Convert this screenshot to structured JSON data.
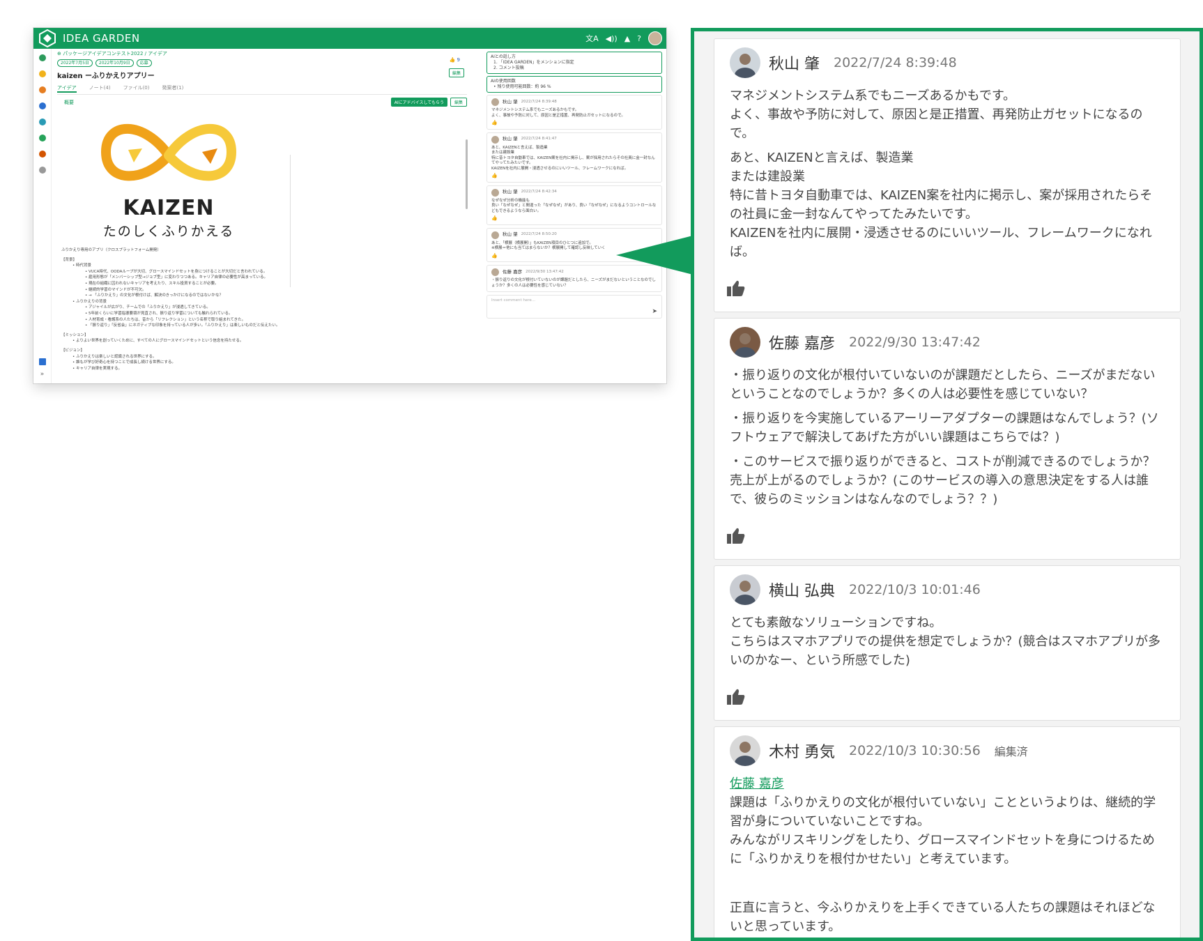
{
  "app": {
    "title": "IDEA GARDEN",
    "breadcrumb": "パッケージアイデアコンテスト2022 / アイデア",
    "chips": [
      "2022年7月5日",
      "2022年10月9日",
      "応募"
    ],
    "idea_title": "kaizen ーふりかえりアプリー",
    "likes": "9",
    "edit_label": "編集",
    "tabs": [
      "アイデア",
      "ノート(4)",
      "ファイル(0)",
      "発案者(1)"
    ],
    "section_label": "概要",
    "ai_button": "AIにアドバイスしてもらう",
    "logo_word": "KAIZEN",
    "logo_sub": "たのしくふりかえる",
    "body_lines": [
      {
        "t": "ふりかえり専用のアプリ（クロスプラットフォーム開発）",
        "lvl": 0
      },
      {
        "t": "",
        "lvl": -1
      },
      {
        "t": "【背景】",
        "lvl": 0
      },
      {
        "t": "• 時代背景",
        "lvl": 1
      },
      {
        "t": "• VUCA時代、OODAループが大切、グロースマインドセットを身につけることが大切だと言われている。",
        "lvl": 2
      },
      {
        "t": "• 雇用形態が「メンバーシップ型→ジョブ型」に変わりつつある。キャリア自律の必要性が高まっている。",
        "lvl": 2
      },
      {
        "t": "• 現在の組織に囚われないキャリアを考えたり、スキル投資することが必要。",
        "lvl": 2
      },
      {
        "t": "• 継続的学習のマインドが不可欠。",
        "lvl": 2
      },
      {
        "t": "• → 「ふりかえり」の文化が根付けば、解決のきっかけになるのではないかな？",
        "lvl": 2
      },
      {
        "t": "• ふりかえりの背景",
        "lvl": 1
      },
      {
        "t": "• アジャイルが広がり、チームでの「ふりかえり」が浸透してきている。",
        "lvl": 2
      },
      {
        "t": "• 5年前くらいに学習指導要領が見直され、振り返り学習についても触れられている。",
        "lvl": 2
      },
      {
        "t": "• 人材育成・看護系の人たちは、昔から「リフレクション」という名称で取り組まれてきた。",
        "lvl": 2
      },
      {
        "t": "• 「振り返り」「反省会」にネガティブな印象を持っている人が多い。「ふりかえり」は楽しいものだと伝えたい。",
        "lvl": 2
      },
      {
        "t": "",
        "lvl": -1
      },
      {
        "t": "【ミッション】",
        "lvl": 0
      },
      {
        "t": "• よりよい世界を創っていくために、すべての人にグロースマインドセットという信念を持たせる。",
        "lvl": 1
      },
      {
        "t": "",
        "lvl": -1
      },
      {
        "t": "【ビジョン】",
        "lvl": 0
      },
      {
        "t": "• ふりかえりは楽しいと認識される世界にする。",
        "lvl": 1
      },
      {
        "t": "• 誰もが学び好奇心を持つことで成長し続ける世界にする。",
        "lvl": 1
      },
      {
        "t": "• キャリア自律を実現する。",
        "lvl": 1
      }
    ],
    "ai_guide": {
      "title": "AIとの話し方",
      "lines": [
        "1. 「IDEA GARDEN」をメンションに指定",
        "2. コメント投稿"
      ]
    },
    "ai_usage": {
      "title": "AIの使用回数",
      "line": "• 残り使用可能回数：約 96 %"
    },
    "mini_comments": [
      {
        "name": "秋山 肇",
        "date": "2022/7/24 8:39:48",
        "lines": [
          "マネジメントシステム系でもニーズあるかもです。",
          "よく、事故や予防に対して、原因と是正措置、再発防止ガセットになるので。"
        ]
      },
      {
        "name": "秋山 肇",
        "date": "2022/7/24 8:41:47",
        "lines": [
          "あと、KAIZENと言えば、製造業",
          "または建設業",
          "特に昔トヨタ自動車では、KAIZEN案を社内に掲示し、案が採用されたらその社員に金一封なんてやってたみたいです。",
          "KAIZENを社内に展開・浸透させるのにいいツール、フレームワークになれば。"
        ]
      },
      {
        "name": "秋山 肇",
        "date": "2022/7/24 8:42:34",
        "lines": [
          "なぜなぜ分析の機能も",
          "良い「なぜなぜ」と間違った「なぜなぜ」があり、良い「なぜなぜ」になるようコントロールなどもできるようなら面白い。"
        ]
      },
      {
        "name": "秋山 肇",
        "date": "2022/7/24 8:50:20",
        "lines": [
          "あと、「横展（横展開）」もKAIZEN項目のひとつに追加で。",
          "※横展＝他にも当てはまらないか？横展開して確認し反映していく"
        ]
      },
      {
        "name": "佐藤 嘉彦",
        "date": "2022/9/30 13:47:42",
        "lines": [
          "・振り返りの文化が根付いていないのが課題だとしたら、ニーズがまだないということなのでしょうか？多くの人は必要性を感じていない？"
        ]
      }
    ],
    "comment_placeholder": "Insert comment here..."
  },
  "zoom_comments": [
    {
      "name": "秋山 肇",
      "date": "2022/7/24 8:39:48",
      "edited": "",
      "mention": "",
      "paragraphs": [
        [
          "マネジメントシステム系でもニーズあるかもです。",
          "よく、事故や予防に対して、原因と是正措置、再発防止ガセットになるので。"
        ],
        [
          "あと、KAIZENと言えば、製造業",
          "または建設業",
          "特に昔トヨタ自動車では、KAIZEN案を社内に掲示し、案が採用されたらその社員に金一封なんてやってたみたいです。",
          "KAIZENを社内に展開・浸透させるのにいいツール、フレームワークになれば。"
        ]
      ]
    },
    {
      "name": "佐藤 嘉彦",
      "date": "2022/9/30 13:47:42",
      "edited": "",
      "mention": "",
      "paragraphs": [
        [
          "・振り返りの文化が根付いていないのが課題だとしたら、ニーズがまだないということなのでしょうか？多くの人は必要性を感じていない？"
        ],
        [
          "・振り返りを今実施しているアーリーアダプターの課題はなんでしょう？(ソフトウェアで解決してあげた方がいい課題はこちらでは？)"
        ],
        [
          "・このサービスで振り返りができると、コストが削減できるのでしょうか？売上が上がるのでしょうか？(このサービスの導入の意思決定をする人は誰で、彼らのミッションはなんなのでしょう？？)"
        ]
      ]
    },
    {
      "name": "横山 弘典",
      "date": "2022/10/3 10:01:46",
      "edited": "",
      "mention": "",
      "paragraphs": [
        [
          "とても素敵なソリューションですね。",
          "こちらはスマホアプリでの提供を想定でしょうか？(競合はスマホアプリが多いのかなー、という所感でした)"
        ]
      ]
    },
    {
      "name": "木村 勇気",
      "date": "2022/10/3 10:30:56",
      "edited": "編集済",
      "mention": "佐藤 嘉彦",
      "paragraphs": [
        [
          "課題は「ふりかえりの文化が根付いていない」ことというよりは、継続的学習が身についていないことですね。",
          "みんながリスキリングをしたり、グロースマインドセットを身につけるために「ふりかえりを根付かせたい」と考えています。"
        ],
        [
          ""
        ],
        [
          "正直に言うと、今ふりかえりを上手くできている人たちの課題はそれほどないと思っています。"
        ]
      ]
    }
  ],
  "colors": {
    "brand": "#129b5c",
    "kaizen_orange": "#f0a21a",
    "kaizen_yellow": "#f6c93a"
  },
  "icons": [
    "idea-garden-logo-icon",
    "translate-icon",
    "megaphone-icon",
    "bell-icon",
    "help-icon",
    "thumbs-up-icon",
    "send-icon",
    "globe-icon"
  ]
}
